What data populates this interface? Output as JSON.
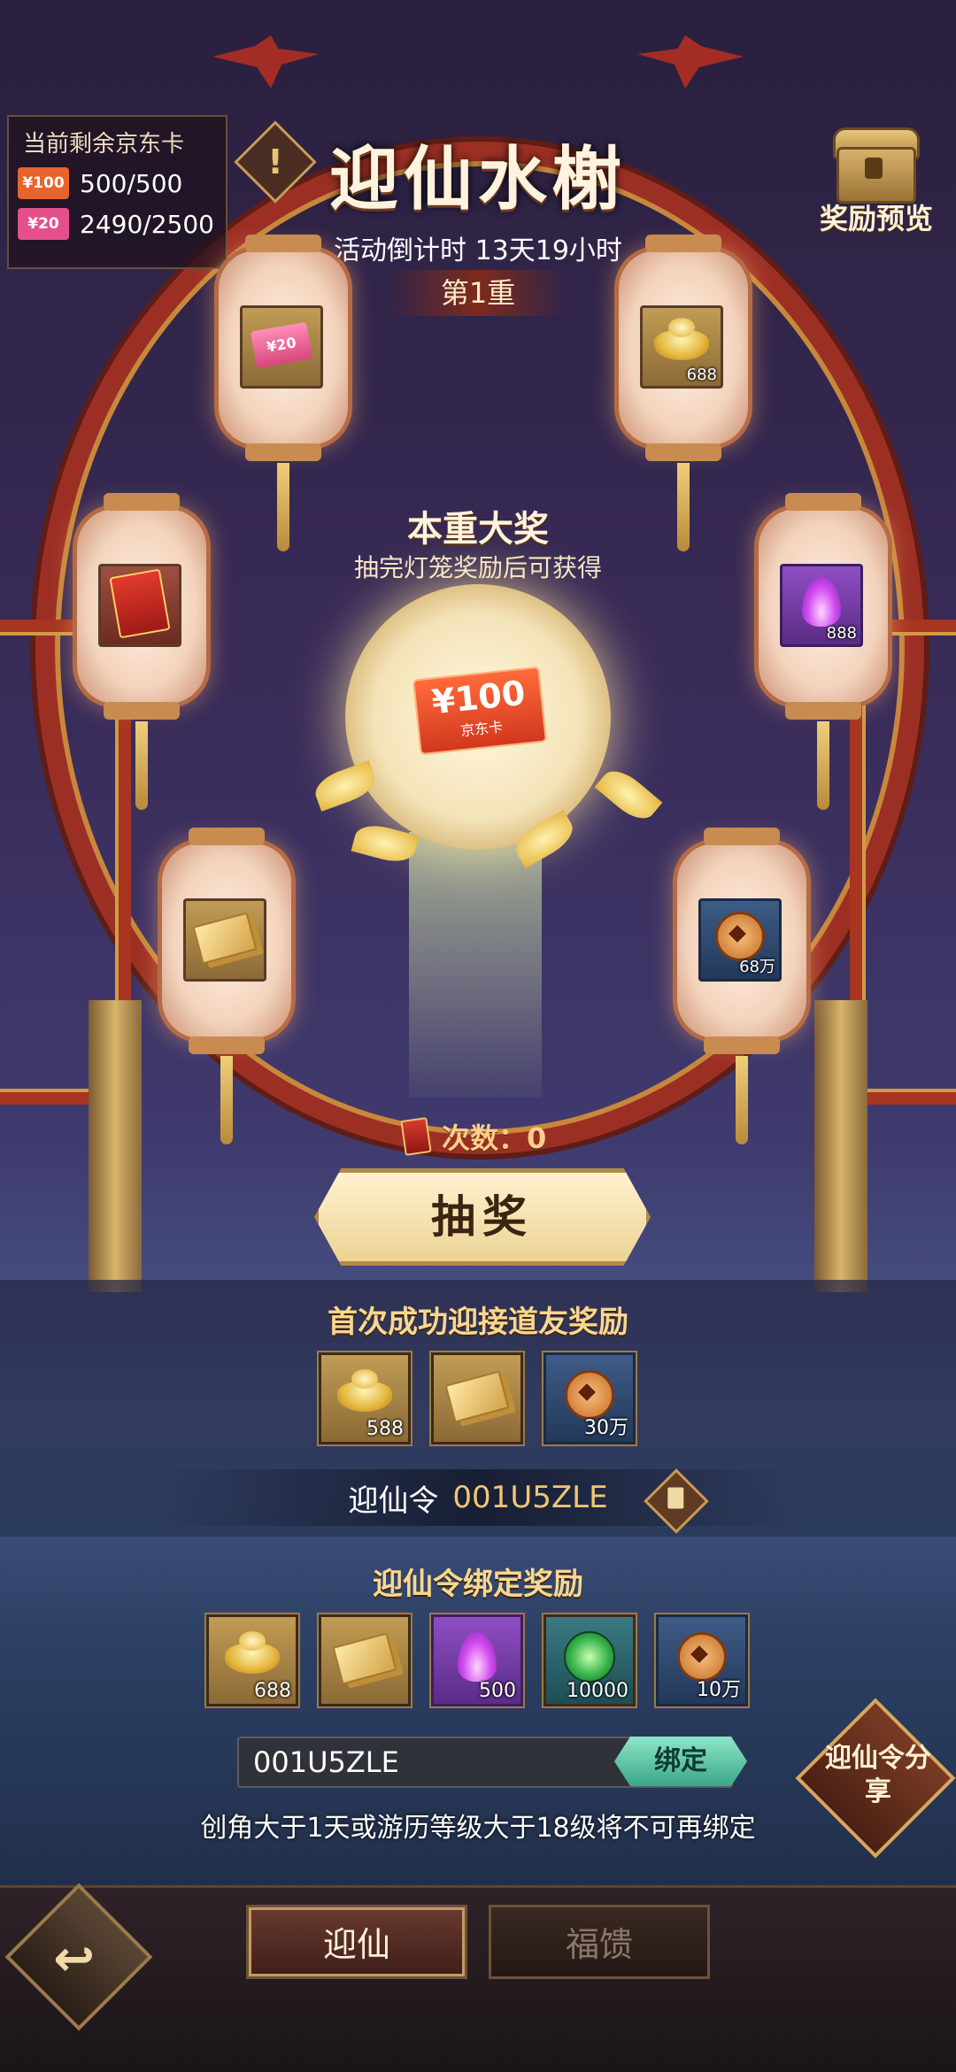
{
  "stock": {
    "header": "当前剩余京东卡",
    "card100_label": "¥100",
    "card100_count": "500/500",
    "card20_label": "¥20",
    "card20_count": "2490/2500"
  },
  "header": {
    "info_icon": "!",
    "title": "迎仙水榭",
    "countdown": "活动倒计时 13天19小时",
    "stage": "第1重",
    "preview_label": "奖励预览"
  },
  "lanterns": [
    {
      "icon": "pink-jd-card",
      "label": "¥20",
      "qty": ""
    },
    {
      "icon": "gold-ingot",
      "label": "",
      "qty": "688"
    },
    {
      "icon": "red-envelope",
      "label": "",
      "qty": ""
    },
    {
      "icon": "purple-flame",
      "label": "",
      "qty": "888"
    },
    {
      "icon": "gold-ticket",
      "label": "",
      "qty": ""
    },
    {
      "icon": "copper-coin",
      "label": "",
      "qty": "68万"
    }
  ],
  "grand_prize": {
    "title": "本重大奖",
    "subtitle": "抽完灯笼奖励后可获得",
    "card_amount": "¥100",
    "card_name": "京东卡"
  },
  "draw": {
    "count_label": "次数：0",
    "button_label": "抽奖"
  },
  "first_reward": {
    "title": "首次成功迎接道友奖励",
    "items": [
      {
        "icon": "gold-ingot",
        "qty": "588"
      },
      {
        "icon": "gold-ticket",
        "qty": ""
      },
      {
        "icon": "copper-coin",
        "qty": "30万"
      }
    ],
    "code_key": "迎仙令",
    "code_value": "001U5ZLE"
  },
  "bind_reward": {
    "title": "迎仙令绑定奖励",
    "items": [
      {
        "icon": "gold-ingot",
        "qty": "688"
      },
      {
        "icon": "gold-ticket",
        "qty": ""
      },
      {
        "icon": "purple-flame",
        "qty": "500"
      },
      {
        "icon": "green-orb",
        "qty": "10000"
      },
      {
        "icon": "copper-coin",
        "qty": "10万"
      }
    ],
    "input_value": "001U5ZLE",
    "bind_button": "绑定",
    "warning": "创角大于1天或游历等级大于18级将不可再绑定",
    "share_label": "迎仙令分享"
  },
  "bottom_nav": {
    "back_icon": "↩",
    "tab_active": "迎仙",
    "tab_inactive": "福馈"
  },
  "colors": {
    "frame_red": "#9c2f24",
    "gold": "#c89a55",
    "bind_green": "#3aa789"
  }
}
